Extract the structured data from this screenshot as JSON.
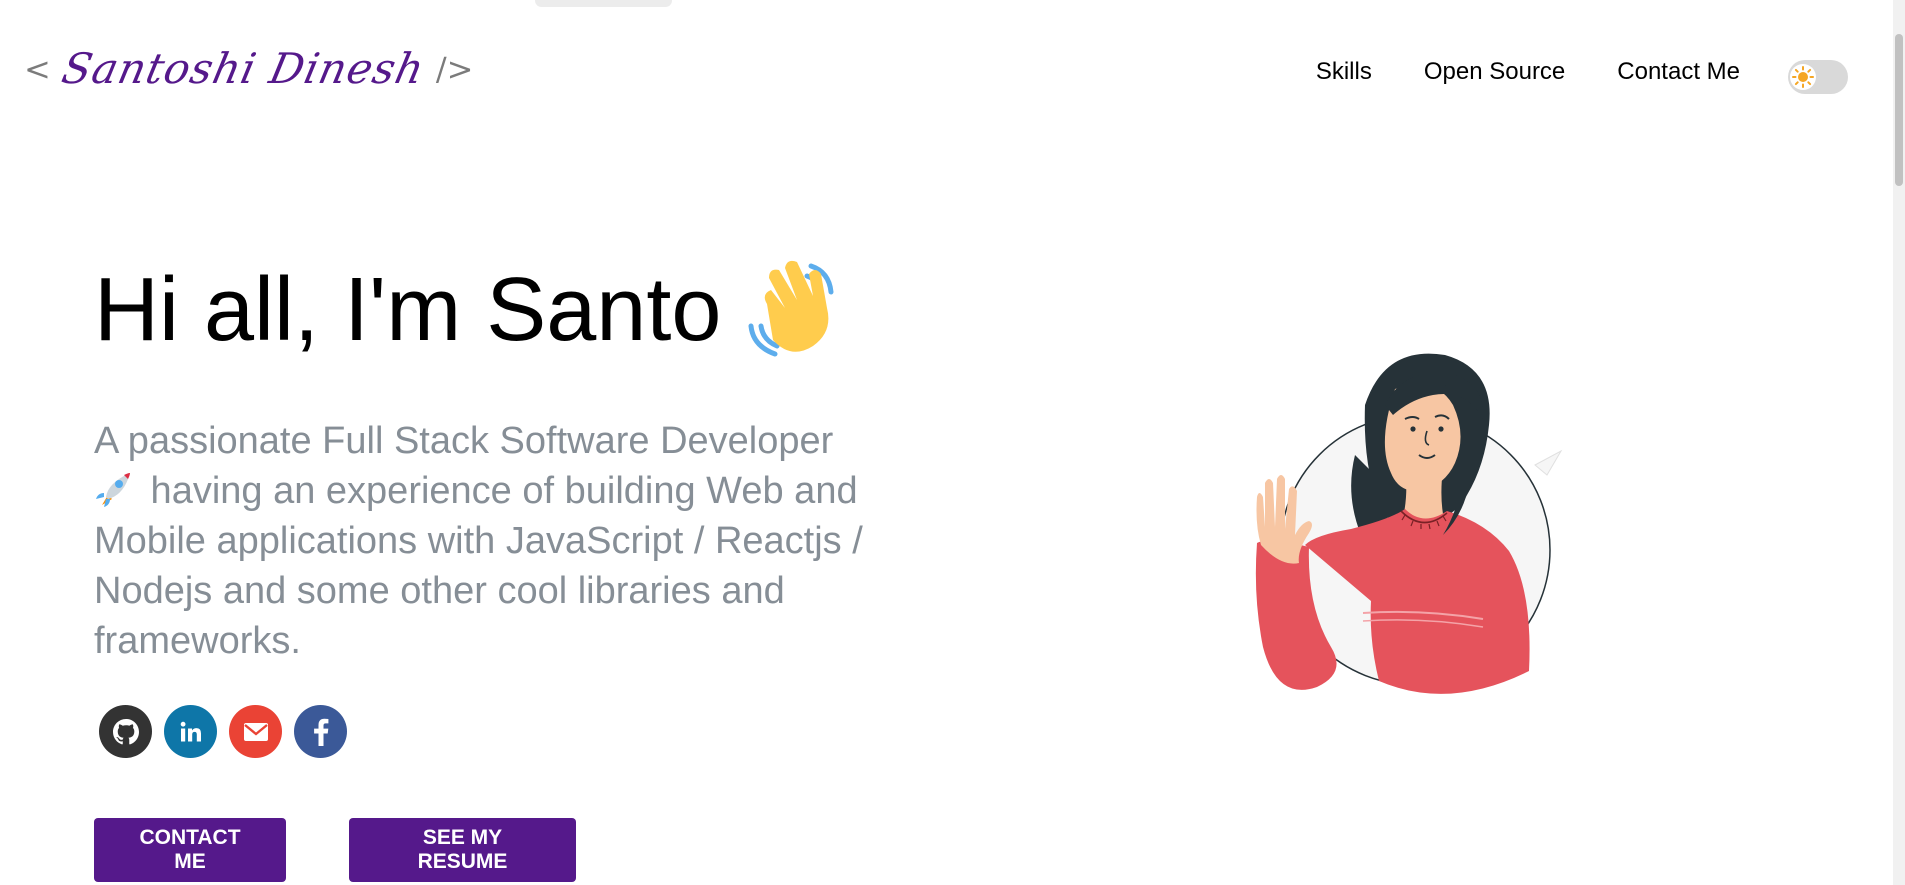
{
  "header": {
    "logo_open": "<",
    "logo_name": "Santoshi Dinesh",
    "logo_close": "/>",
    "nav": [
      {
        "label": "Skills"
      },
      {
        "label": "Open Source"
      },
      {
        "label": "Contact Me"
      }
    ],
    "theme_toggle_icon": "sun-icon"
  },
  "hero": {
    "greeting": "Hi all, I'm Santo",
    "wave_icon": "waving-hand-icon",
    "subtitle_before": "A passionate Full Stack Software Developer",
    "subtitle_icon": "rocket-icon",
    "subtitle_after": " having an experience of building Web and Mobile applications with JavaScript / Reactjs / Nodejs and some other cool libraries and frameworks.",
    "socials": [
      {
        "name": "github-icon",
        "color": "#333333"
      },
      {
        "name": "linkedin-icon",
        "color": "#0e76a8"
      },
      {
        "name": "gmail-icon",
        "color": "#ea4335"
      },
      {
        "name": "facebook-icon",
        "color": "#3b5998"
      }
    ],
    "contact_button": "CONTACT ME",
    "resume_button": "SEE MY RESUME"
  },
  "colors": {
    "brand": "#55198b",
    "subtitle_text": "#868e96"
  }
}
